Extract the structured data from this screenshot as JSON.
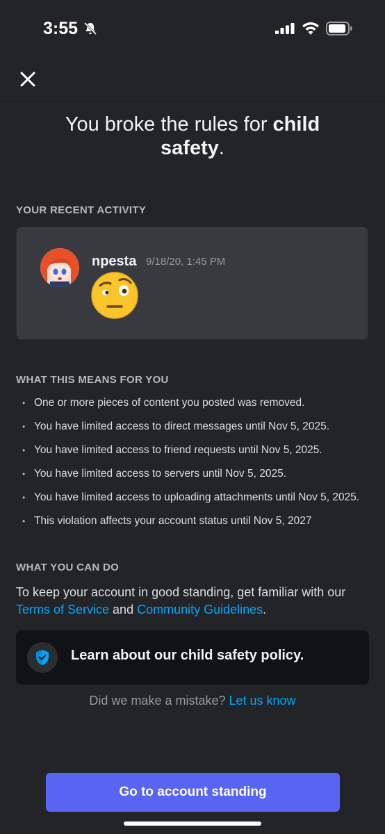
{
  "status_bar": {
    "time": "3:55"
  },
  "header": {
    "title_prefix": "You broke the rules for ",
    "title_bold": "child safety",
    "title_suffix": "."
  },
  "recent_activity": {
    "label": "YOUR RECENT ACTIVITY",
    "username": "npesta",
    "timestamp": "9/18/20, 1:45 PM",
    "message_emoji": "face-with-raised-eyebrow"
  },
  "consequences": {
    "label": "WHAT THIS MEANS FOR YOU",
    "items": [
      "One or more pieces of content you posted was removed.",
      "You have limited access to direct messages until Nov 5, 2025.",
      "You have limited access to friend requests until Nov 5, 2025.",
      "You have limited access to servers until Nov 5, 2025.",
      "You have limited access to uploading attachments until Nov 5, 2025.",
      "This violation affects your account status until Nov 5, 2027"
    ]
  },
  "actions": {
    "label": "WHAT YOU CAN DO",
    "text_before": "To keep your account in good standing, get familiar with our ",
    "terms_link": "Terms of Service",
    "text_and": " and ",
    "guidelines_link": "Community Guidelines",
    "text_end": ".",
    "policy_card_label": "Learn about our child safety policy.",
    "mistake_text": "Did we make a mistake? ",
    "mistake_link": "Let us know"
  },
  "footer": {
    "cta_label": "Go to account standing"
  },
  "colors": {
    "background": "#232428",
    "card": "#383a40",
    "link": "#00a8fc",
    "brand": "#5865f2",
    "policy_card": "#111214"
  }
}
